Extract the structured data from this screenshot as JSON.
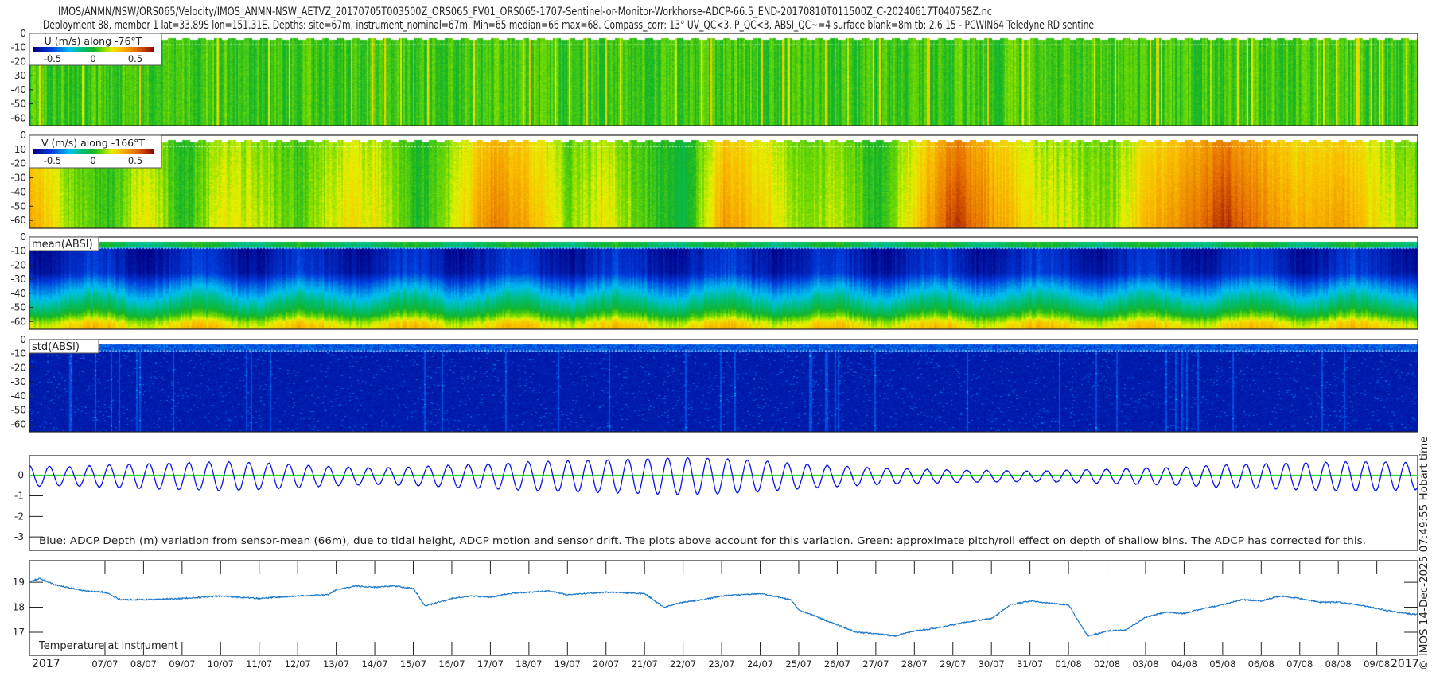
{
  "title": {
    "line1": "IMOS/ANMN/NSW/ORS065/Velocity/IMOS_ANMN-NSW_AETVZ_20170705T003500Z_ORS065_FV01_ORS065-1707-Sentinel-or-Monitor-Workhorse-ADCP-66.5_END-20170810T011500Z_C-20240617T040758Z.nc",
    "line2": "Deployment 88, member 1 lat=33.89S lon=151.31E. Depths: site=67m, instrument_nominal=67m. Min=65 median=66 max=68. Compass_corr: 13° UV_QC<3, P_QC<3, ABSI_QC~=4 surface blank=8m tb: 2.6.15 - PCWIN64 Teledyne RD sentinel"
  },
  "footer": {
    "copyright": "© IMOS 14-Dec-2025 07:49:55 Hobart time"
  },
  "colors": {
    "depth_line": "#0a14e6",
    "pitch_roll_line": "#22dd22",
    "temperature_line": "#1f78c8",
    "axis": "#222222"
  },
  "chart_data": [
    {
      "type": "heatmap",
      "name": "U",
      "legend_title": "U (m/s) along -76°T",
      "colorbar_ticks": [
        "-0.5",
        "0",
        "0.5"
      ],
      "clim": [
        -0.7,
        0.7
      ],
      "ylabel_ticks": [
        "0",
        "-10",
        "-20",
        "-30",
        "-40",
        "-50",
        "-60"
      ],
      "ylim": [
        0,
        65.5
      ],
      "surface_blank_depth": 8,
      "daily_mean": [
        0.05,
        0.04,
        0.06,
        0.05,
        0.05,
        0.06,
        0.04,
        0.05,
        0.05,
        0.06,
        0.05,
        0.03,
        0.05,
        0.06,
        0.05,
        0.04,
        0.04,
        0.05,
        0.06,
        0.05,
        0.04,
        0.03,
        0.04,
        0.05,
        0.06,
        0.05,
        0.08,
        0.06,
        0.05,
        0.04,
        0.05,
        0.04,
        0.05,
        0.04,
        0.05,
        0.04,
        0.03
      ]
    },
    {
      "type": "heatmap",
      "name": "V",
      "legend_title": "V (m/s) along -166°T",
      "colorbar_ticks": [
        "-0.5",
        "0",
        "0.5"
      ],
      "clim": [
        -0.7,
        0.7
      ],
      "ylabel_ticks": [
        "0",
        "-10",
        "-20",
        "-30",
        "-40",
        "-50",
        "-60"
      ],
      "ylim": [
        0,
        65.5
      ],
      "daily_mean": [
        0.35,
        0.12,
        0.02,
        0.22,
        0.0,
        0.2,
        0.15,
        0.05,
        0.2,
        0.2,
        0.0,
        0.15,
        0.42,
        0.3,
        0.1,
        0.2,
        0.05,
        -0.05,
        0.35,
        0.25,
        0.1,
        0.15,
        0.0,
        0.25,
        0.55,
        0.35,
        0.2,
        0.15,
        0.1,
        0.3,
        0.4,
        0.55,
        0.4,
        0.3,
        0.35,
        0.2,
        0.1
      ]
    },
    {
      "type": "heatmap",
      "name": "mean(ABSI)",
      "label": "mean(ABSI)",
      "ylabel_ticks": [
        "0",
        "-10",
        "-20",
        "-30",
        "-40",
        "-50",
        "-60"
      ],
      "ylim": [
        0,
        65.5
      ],
      "profile_depths": [
        3,
        7,
        8,
        25,
        33,
        42,
        50,
        55,
        60,
        65.5
      ],
      "profile_levels": [
        0.45,
        0.45,
        0.08,
        0.1,
        0.22,
        0.33,
        0.43,
        0.52,
        0.64,
        0.7
      ]
    },
    {
      "type": "heatmap",
      "name": "std(ABSI)",
      "label": "std(ABSI)",
      "ylabel_ticks": [
        "0",
        "-10",
        "-20",
        "-30",
        "-40",
        "-50",
        "-60"
      ],
      "ylim": [
        0,
        65.5
      ]
    },
    {
      "type": "line",
      "name": "ADCP depth variation",
      "ylabel_ticks": [
        "0",
        "-1",
        "-2",
        "-3"
      ],
      "ylim": [
        0.95,
        -3.65
      ],
      "tidal_period_days": 0.5175,
      "daily_amplitude_m": [
        0.5,
        0.45,
        0.55,
        0.6,
        0.65,
        0.7,
        0.65,
        0.55,
        0.45,
        0.4,
        0.45,
        0.55,
        0.6,
        0.7,
        0.75,
        0.8,
        0.85,
        0.9,
        0.85,
        0.75,
        0.6,
        0.5,
        0.4,
        0.35,
        0.3,
        0.28,
        0.25,
        0.3,
        0.35,
        0.4,
        0.45,
        0.55,
        0.6,
        0.65,
        0.7,
        0.7,
        0.65
      ],
      "annotation": "Blue: ADCP Depth (m) variation from sensor-mean (66m), due to tidal height, ADCP motion and sensor drift. The plots above account for this variation. Green: approximate pitch/roll effect on depth of shallow bins. The ADCP has corrected for this."
    },
    {
      "type": "line",
      "name": "Temperature at instrument",
      "label": "Temperature at instrument",
      "ylabel_ticks": [
        "19",
        "18",
        "17"
      ],
      "ylim": [
        16.08,
        19.86
      ],
      "x_days": [
        -0.96,
        -0.7,
        -0.3,
        0,
        0.5,
        1,
        1.4,
        2,
        3,
        4,
        5,
        6,
        6.8,
        7,
        7.5,
        8,
        8.5,
        9,
        9.3,
        10,
        10.5,
        11,
        11.5,
        12,
        12.5,
        13,
        14,
        15,
        15.5,
        16,
        16.5,
        17,
        17.5,
        18,
        18.8,
        19,
        19.5,
        20,
        20.5,
        21,
        21.5,
        22,
        22.5,
        23,
        23.5,
        24,
        24.5,
        25,
        25.3,
        25.6,
        26,
        26.5,
        27,
        27.5,
        28,
        28.5,
        29,
        29.5,
        30,
        30.5,
        31,
        31.5,
        32,
        32.5,
        33,
        33.5,
        34,
        34.5,
        35.06
      ],
      "values": [
        19.0,
        19.15,
        18.9,
        18.8,
        18.65,
        18.6,
        18.3,
        18.3,
        18.35,
        18.45,
        18.35,
        18.45,
        18.5,
        18.7,
        18.85,
        18.8,
        18.85,
        18.75,
        18.05,
        18.35,
        18.45,
        18.4,
        18.55,
        18.6,
        18.65,
        18.5,
        18.6,
        18.55,
        18.0,
        18.2,
        18.3,
        18.45,
        18.5,
        18.55,
        18.3,
        17.9,
        17.6,
        17.3,
        17.0,
        16.95,
        16.85,
        17.05,
        17.15,
        17.3,
        17.45,
        17.55,
        18.1,
        18.25,
        18.2,
        18.15,
        18.1,
        16.85,
        17.05,
        17.1,
        17.6,
        17.8,
        17.75,
        17.95,
        18.1,
        18.3,
        18.25,
        18.45,
        18.35,
        18.2,
        18.2,
        18.1,
        17.95,
        17.8,
        17.7
      ]
    }
  ],
  "xaxis": {
    "start_label": "2017",
    "end_label": "2017",
    "date_labels": [
      "07/07",
      "08/07",
      "09/07",
      "10/07",
      "11/07",
      "12/07",
      "13/07",
      "14/07",
      "15/07",
      "16/07",
      "17/07",
      "18/07",
      "19/07",
      "20/07",
      "21/07",
      "22/07",
      "23/07",
      "24/07",
      "25/07",
      "26/07",
      "27/07",
      "28/07",
      "29/07",
      "30/07",
      "31/07",
      "01/08",
      "02/08",
      "03/08",
      "04/08",
      "05/08",
      "06/08",
      "07/08",
      "08/08",
      "09/08"
    ],
    "xlim_days": [
      -0.96,
      35.06
    ]
  }
}
